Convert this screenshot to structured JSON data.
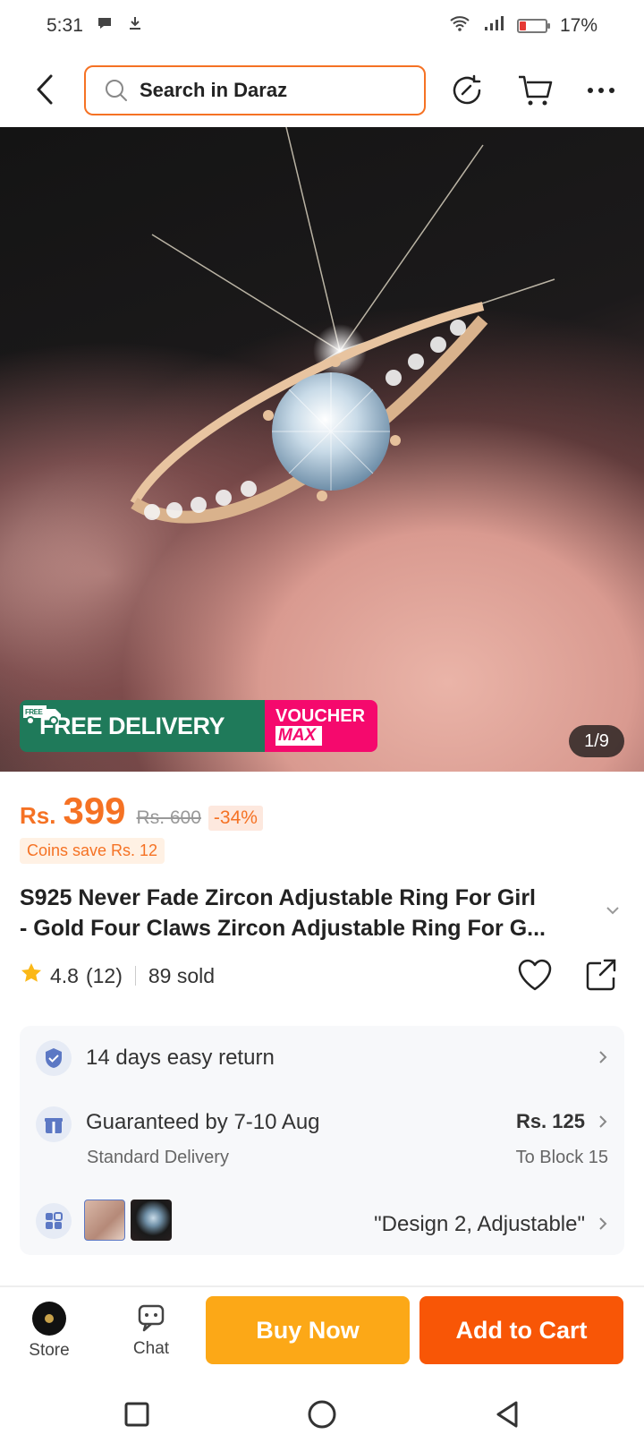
{
  "status_bar": {
    "time": "5:31",
    "battery": "17%"
  },
  "header": {
    "search_placeholder": "Search in Daraz"
  },
  "hero": {
    "promo_free_badge": "FREE",
    "promo_free_delivery": "FREE DELIVERY",
    "promo_voucher_line1": "VOUCHER",
    "promo_voucher_line2": "MAX",
    "page_indicator": "1/9"
  },
  "price": {
    "currency": "Rs.",
    "value": "399",
    "old": "Rs. 600",
    "discount": "-34%",
    "coins": "Coins save Rs. 12"
  },
  "product": {
    "title_line1": "S925 Never Fade Zircon Adjustable Ring For Girl",
    "title_line2": "- Gold Four Claws Zircon Adjustable Ring For G...",
    "rating": "4.8",
    "reviews": "(12)",
    "sold": "89 sold"
  },
  "info": {
    "return_label": "14 days easy return",
    "delivery_label": "Guaranteed by 7-10 Aug",
    "delivery_type": "Standard Delivery",
    "delivery_price": "Rs. 125",
    "delivery_location": "To Block 15",
    "variant": "\"Design 2, Adjustable\""
  },
  "actions": {
    "store": "Store",
    "chat": "Chat",
    "buy_now": "Buy Now",
    "add_to_cart": "Add to Cart"
  },
  "colors": {
    "accent": "#f57224",
    "buy_now": "#fca817",
    "add_to_cart": "#f85606",
    "promo_green": "#1f7a5a",
    "promo_pink": "#f5096d"
  },
  "icons": [
    "chat-bubble-icon",
    "download-icon",
    "wifi-icon",
    "signal-icon",
    "battery-icon",
    "back-icon",
    "search-icon",
    "history-icon",
    "cart-icon",
    "more-icon",
    "truck-icon",
    "star-icon",
    "heart-icon",
    "share-icon",
    "shield-icon",
    "gift-icon",
    "grid-icon",
    "chevron-right-icon",
    "chevron-down-icon",
    "store-logo",
    "chat-icon",
    "square-icon",
    "circle-icon",
    "triangle-icon"
  ]
}
